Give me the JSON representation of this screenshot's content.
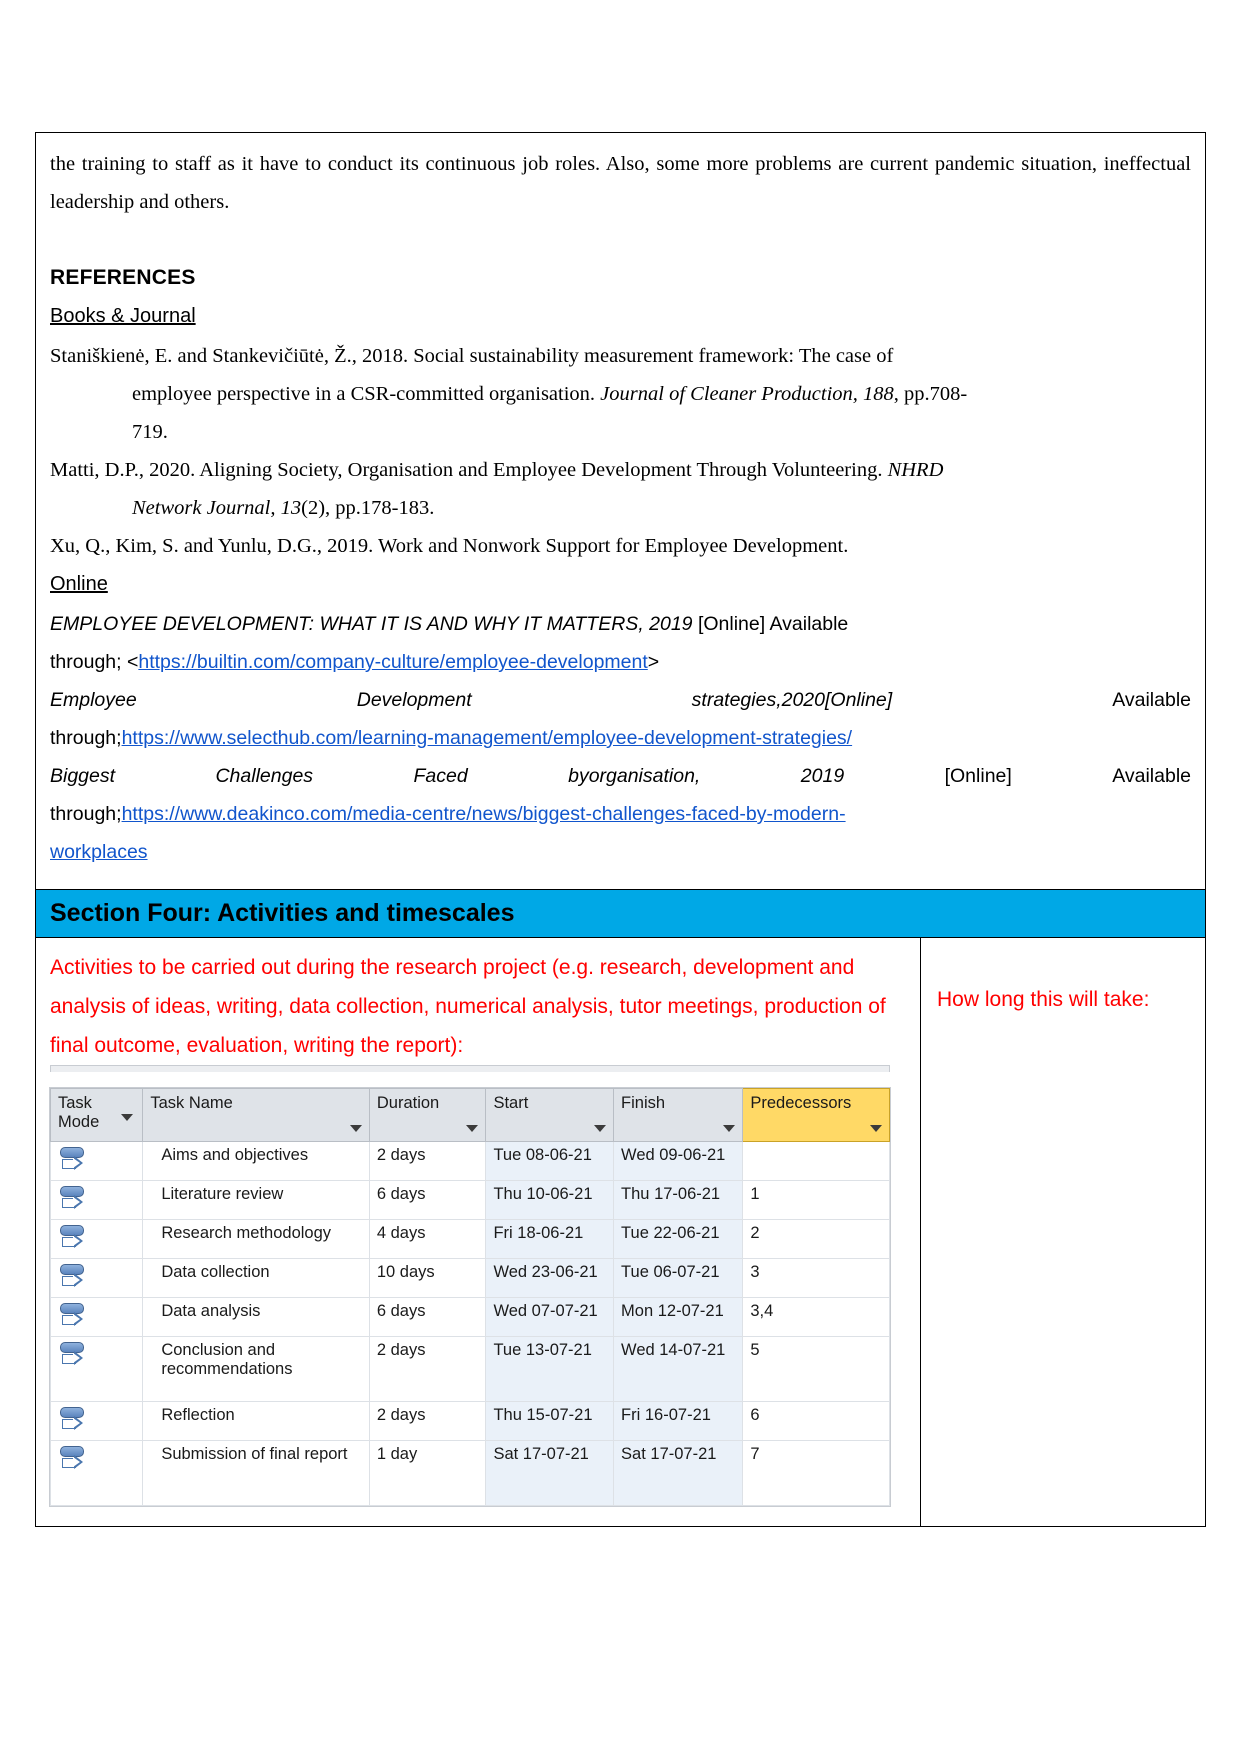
{
  "body": {
    "intro_paragraph": "the training to staff as it have to conduct its continuous job roles. Also, some more problems are current pandemic situation, ineffectual leadership and others.",
    "references_heading": "REFERENCES",
    "books_heading": "Books & Journal ",
    "online_heading": "Online",
    "references": [
      {
        "line1": "Staniškienė, E. and Stankevičiūtė, Ž., 2018. Social sustainability measurement framework: The case of",
        "line2_plain_a": "employee perspective in a CSR-committed organisation. ",
        "line2_italic": "Journal of Cleaner Production, 188",
        "line2_plain_b": ", pp.708-",
        "line3": "719."
      },
      {
        "line1": "Matti, D.P., 2020. Aligning Society, Organisation and Employee Development Through Volunteering. ",
        "line1_italic_tail": "NHRD",
        "line2_italic": "Network Journal, 13",
        "line2_plain": "(2), pp.178-183."
      },
      {
        "line1": "Xu, Q., Kim, S. and Yunlu, D.G., 2019. Work and Nonwork Support for Employee Development."
      }
    ],
    "online_refs": [
      {
        "title": "EMPLOYEE DEVELOPMENT: WHAT IT IS AND WHY IT MATTERS, 2019",
        "online_tag": "[Online]",
        "available": "Available",
        "through": "through; <",
        "url": "https://builtin.com/company-culture/employee-development",
        "close": ">"
      },
      {
        "words": [
          "Employee",
          "Development",
          "strategies,2020[Online]",
          "Available"
        ],
        "through": "through;",
        "url": "https://www.selecthub.com/learning-management/employee-development-strategies/"
      },
      {
        "words": [
          "Biggest",
          "Challenges",
          "Faced",
          "byorganisation,",
          "2019",
          "[Online]",
          "Available"
        ],
        "through": "through;",
        "url_line1": "https://www.deakinco.com/media-centre/news/biggest-challenges-faced-by-modern-",
        "url_line2": "workplaces"
      }
    ]
  },
  "section_four": {
    "banner_title": "Section Four: Activities and timescales",
    "activities_prompt": "Activities to be carried out during the research project (e.g. research, development and analysis of ideas, writing, data collection, numerical analysis, tutor meetings, production of final outcome, evaluation, writing the report):",
    "duration_prompt": "How long this will take:",
    "accent_blue": "#00A8E6",
    "prompt_red": "#FF0000",
    "predecessor_header_yellow": "#FFD966"
  },
  "project_table": {
    "headers": {
      "task_mode": "Task Mode",
      "task_name": "Task Name",
      "duration": "Duration",
      "start": "Start",
      "finish": "Finish",
      "predecessors": "Predecessors"
    },
    "rows": [
      {
        "task_mode_icon": "manually-scheduled-icon",
        "task_name": "Aims and objectives",
        "duration": "2 days",
        "start": "Tue 08-06-21",
        "finish": "Wed 09-06-21",
        "predecessors": ""
      },
      {
        "task_mode_icon": "manually-scheduled-icon",
        "task_name": "Literature review",
        "duration": "6 days",
        "start": "Thu 10-06-21",
        "finish": "Thu 17-06-21",
        "predecessors": "1"
      },
      {
        "task_mode_icon": "manually-scheduled-icon",
        "task_name": "Research methodology",
        "duration": "4 days",
        "start": "Fri 18-06-21",
        "finish": "Tue 22-06-21",
        "predecessors": "2"
      },
      {
        "task_mode_icon": "manually-scheduled-icon",
        "task_name": "Data collection",
        "duration": "10 days",
        "start": "Wed 23-06-21",
        "finish": "Tue 06-07-21",
        "predecessors": "3"
      },
      {
        "task_mode_icon": "manually-scheduled-icon",
        "task_name": "Data analysis",
        "duration": "6 days",
        "start": "Wed 07-07-21",
        "finish": "Mon 12-07-21",
        "predecessors": "3,4"
      },
      {
        "task_mode_icon": "manually-scheduled-icon",
        "task_name": "Conclusion and recommendations",
        "duration": "2 days",
        "start": "Tue 13-07-21",
        "finish": "Wed 14-07-21",
        "predecessors": "5"
      },
      {
        "task_mode_icon": "manually-scheduled-icon",
        "task_name": "Reflection",
        "duration": "2 days",
        "start": "Thu 15-07-21",
        "finish": "Fri 16-07-21",
        "predecessors": "6"
      },
      {
        "task_mode_icon": "manually-scheduled-icon",
        "task_name": "Submission of final report",
        "duration": "1 day",
        "start": "Sat 17-07-21",
        "finish": "Sat 17-07-21",
        "predecessors": "7"
      }
    ]
  }
}
